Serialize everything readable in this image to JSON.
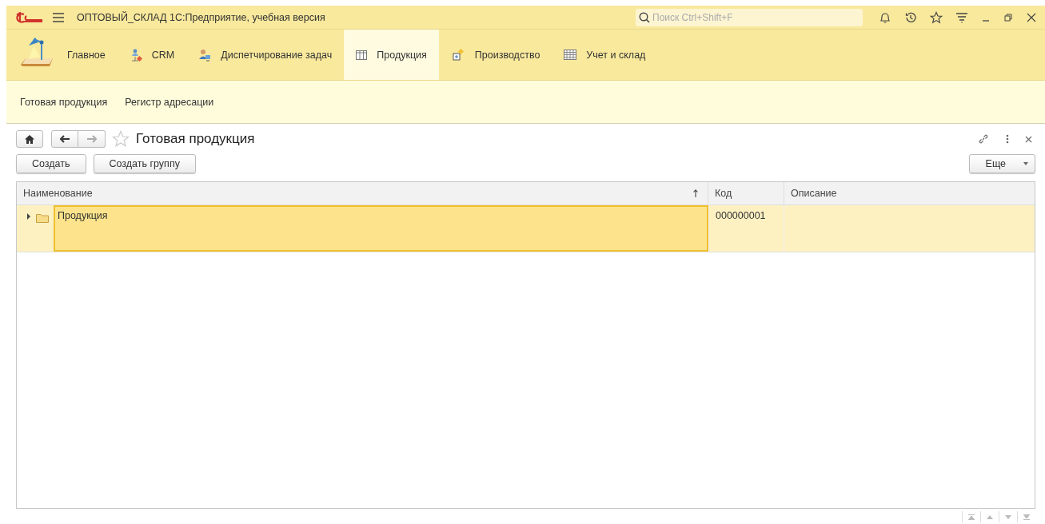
{
  "window": {
    "title": "ОПТОВЫЙ_СКЛАД 1С:Предприятие, учебная версия"
  },
  "search": {
    "placeholder": "Поиск Ctrl+Shift+F"
  },
  "sections": [
    {
      "label": "Главное",
      "kind": "lamp",
      "selected": false
    },
    {
      "label": "CRM",
      "kind": "crm",
      "selected": false
    },
    {
      "label": "Диспетчирование задач",
      "kind": "person",
      "selected": false
    },
    {
      "label": "Продукция",
      "kind": "table",
      "selected": true
    },
    {
      "label": "Производство",
      "kind": "box",
      "selected": false
    },
    {
      "label": "Учет и склад",
      "kind": "grid",
      "selected": false
    }
  ],
  "subsections": [
    "Готовая продукция",
    "Регистр адресации"
  ],
  "form": {
    "title": "Готовая продукция",
    "favorite": false
  },
  "buttons": [
    "Создать",
    "Создать группу"
  ],
  "more_button": "Еще",
  "table": {
    "columns": [
      {
        "label": "Наименование",
        "sorted": true
      },
      {
        "label": "Код",
        "sorted": false
      },
      {
        "label": "Описание",
        "sorted": false
      }
    ],
    "rows": [
      {
        "name": "Продукция",
        "code": "000000001",
        "selected": true,
        "expanded": false,
        "name_focused": true
      }
    ]
  }
}
